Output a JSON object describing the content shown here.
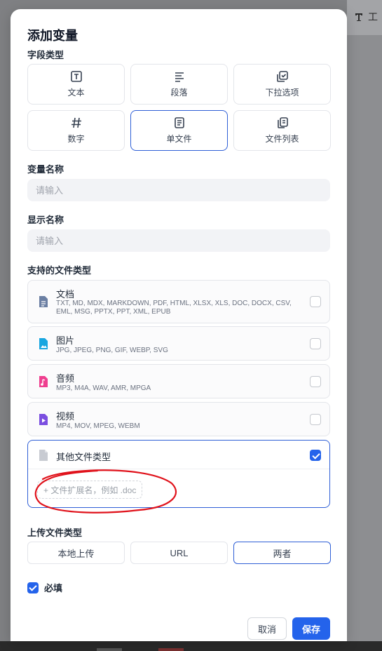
{
  "background": {
    "tool_label": "工"
  },
  "dialog": {
    "title": "添加变量",
    "field_type_label": "字段类型",
    "field_types": [
      {
        "label": "文本",
        "icon": "text-icon"
      },
      {
        "label": "段落",
        "icon": "paragraph-icon"
      },
      {
        "label": "下拉选项",
        "icon": "select-icon"
      },
      {
        "label": "数字",
        "icon": "number-icon"
      },
      {
        "label": "单文件",
        "icon": "file-icon",
        "selected": true
      },
      {
        "label": "文件列表",
        "icon": "file-list-icon"
      }
    ],
    "variable_name": {
      "label": "变量名称",
      "placeholder": "请输入",
      "value": ""
    },
    "display_name": {
      "label": "显示名称",
      "placeholder": "请输入",
      "value": ""
    },
    "file_types_label": "支持的文件类型",
    "file_types": [
      {
        "name": "文档",
        "extensions": "TXT, MD, MDX, MARKDOWN, PDF, HTML, XLSX, XLS, DOC, DOCX, CSV, EML, MSG, PPTX, PPT, XML, EPUB",
        "icon": "document-icon",
        "color": "#6b7fa3",
        "checked": false
      },
      {
        "name": "图片",
        "extensions": "JPG, JPEG, PNG, GIF, WEBP, SVG",
        "icon": "image-icon",
        "color": "#18a6e0",
        "checked": false
      },
      {
        "name": "音频",
        "extensions": "MP3, M4A, WAV, AMR, MPGA",
        "icon": "audio-icon",
        "color": "#ef3f8f",
        "checked": false
      },
      {
        "name": "视频",
        "extensions": "MP4, MOV, MPEG, WEBM",
        "icon": "video-icon",
        "color": "#7b4fe0",
        "checked": false
      }
    ],
    "other_file_type": {
      "name": "其他文件类型",
      "checked": true,
      "add_placeholder": "+ 文件扩展名，例如 .doc"
    },
    "upload_type_label": "上传文件类型",
    "upload_options": [
      {
        "label": "本地上传"
      },
      {
        "label": "URL"
      },
      {
        "label": "两者",
        "selected": true
      }
    ],
    "required_label": "必填",
    "required_checked": true,
    "cancel_label": "取消",
    "save_label": "保存"
  },
  "colors": {
    "accent": "#2463eb",
    "selected_border": "#2f5fd6",
    "annotation": "#e0121b"
  }
}
